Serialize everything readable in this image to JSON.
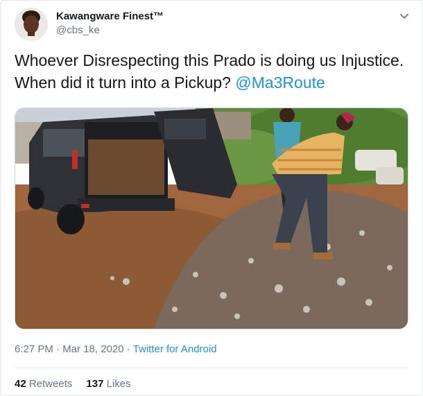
{
  "user": {
    "display_name": "Kawangware Finest™",
    "handle": "@cbs_ke",
    "avatar_icon": "profile-photo"
  },
  "tweet": {
    "text_before_link": "Whoever Disrespecting this Prado is doing us Injustice. When did it turn into a Pickup? ",
    "mention": "@Ma3Route",
    "image_description_icon": "photo"
  },
  "meta": {
    "time": "6:27 PM",
    "sep1": " · ",
    "date": "Mar 18, 2020",
    "sep2": " · ",
    "source": "Twitter for Android"
  },
  "stats": {
    "retweets_count": "42",
    "retweets_label": "Retweets",
    "likes_count": "137",
    "likes_label": "Likes"
  },
  "colors": {
    "link": "#1b95e0",
    "secondary_text": "#657786",
    "primary_text": "#14171a"
  }
}
